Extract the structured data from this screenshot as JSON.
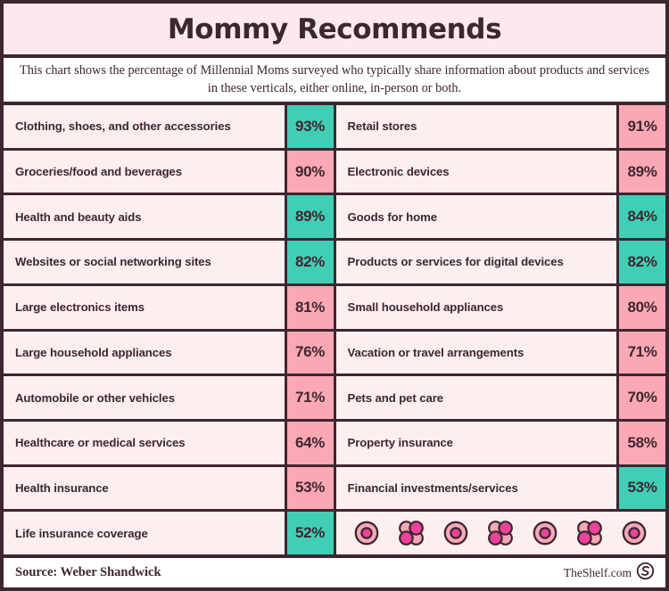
{
  "header": {
    "title": "Mommy Recommends",
    "subtitle": "This chart shows the percentage of Millennial Moms surveyed who typically share information about products and services in these verticals, either online, in-person or both."
  },
  "colors": {
    "frame": "#3E2630",
    "title_band": "#FCE9EE",
    "row_bg": "#FDEEF0",
    "teal": "#40CFB4",
    "pink": "#FBA8B4",
    "magenta": "#F0429A",
    "petal_light": "#F5A8B8"
  },
  "chart_data": {
    "type": "table",
    "title": "Mommy Recommends",
    "subtitle": "This chart shows the percentage of Millennial Moms surveyed who typically share information about products and services in these verticals, either online, in-person or both.",
    "unit": "%",
    "source": "Weber Shandwick",
    "columns": [
      "vertical",
      "percentage"
    ],
    "left_column": [
      {
        "label": "Clothing, shoes, and other accessories",
        "value": 93,
        "display": "93%",
        "highlight": "teal"
      },
      {
        "label": "Groceries/food and beverages",
        "value": 90,
        "display": "90%",
        "highlight": "pink"
      },
      {
        "label": "Health and beauty aids",
        "value": 89,
        "display": "89%",
        "highlight": "teal"
      },
      {
        "label": "Websites or social networking sites",
        "value": 82,
        "display": "82%",
        "highlight": "teal"
      },
      {
        "label": "Large electronics items",
        "value": 81,
        "display": "81%",
        "highlight": "pink"
      },
      {
        "label": "Large household appliances",
        "value": 76,
        "display": "76%",
        "highlight": "pink"
      },
      {
        "label": "Automobile or other vehicles",
        "value": 71,
        "display": "71%",
        "highlight": "pink"
      },
      {
        "label": "Healthcare or medical services",
        "value": 64,
        "display": "64%",
        "highlight": "pink"
      },
      {
        "label": "Health insurance",
        "value": 53,
        "display": "53%",
        "highlight": "pink"
      },
      {
        "label": "Life insurance coverage",
        "value": 52,
        "display": "52%",
        "highlight": "teal"
      }
    ],
    "right_column": [
      {
        "label": "Retail stores",
        "value": 91,
        "display": "91%",
        "highlight": "pink"
      },
      {
        "label": "Electronic devices",
        "value": 89,
        "display": "89%",
        "highlight": "pink"
      },
      {
        "label": "Goods for home",
        "value": 84,
        "display": "84%",
        "highlight": "teal"
      },
      {
        "label": "Products or services for digital devices",
        "value": 82,
        "display": "82%",
        "highlight": "teal"
      },
      {
        "label": "Small household appliances",
        "value": 80,
        "display": "80%",
        "highlight": "pink"
      },
      {
        "label": "Vacation or travel arrangements",
        "value": 71,
        "display": "71%",
        "highlight": "pink"
      },
      {
        "label": "Pets and pet care",
        "value": 70,
        "display": "70%",
        "highlight": "pink"
      },
      {
        "label": "Property insurance",
        "value": 58,
        "display": "58%",
        "highlight": "pink"
      },
      {
        "label": "Financial investments/services",
        "value": 53,
        "display": "53%",
        "highlight": "teal"
      },
      {
        "label": "",
        "value": null,
        "display": "",
        "highlight": "none",
        "decorative_icons": [
          "circle-icon",
          "flower-icon",
          "circle-icon",
          "flower-icon",
          "circle-icon",
          "flower-icon",
          "circle-icon"
        ]
      }
    ]
  },
  "footer": {
    "source": "Source: Weber Shandwick",
    "brand": "TheShelf.com",
    "logo": "shelf-s-logo-icon"
  }
}
